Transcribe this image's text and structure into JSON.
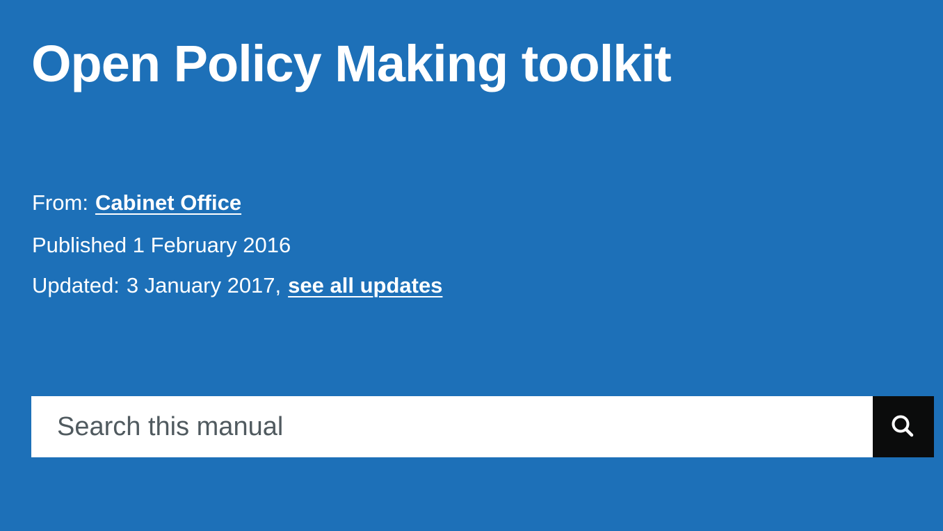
{
  "page": {
    "title": "Open Policy Making toolkit"
  },
  "metadata": {
    "from_label": "From:",
    "from_link": "Cabinet Office",
    "published": "Published 1 February 2016",
    "updated_label": "Updated:",
    "updated_date": "3 January 2017,",
    "updates_link": "see all updates"
  },
  "search": {
    "placeholder": "Search this manual",
    "button_icon": "search-icon"
  },
  "colors": {
    "background": "#1d70b8",
    "text": "#ffffff",
    "search_button": "#0b0c0c"
  }
}
